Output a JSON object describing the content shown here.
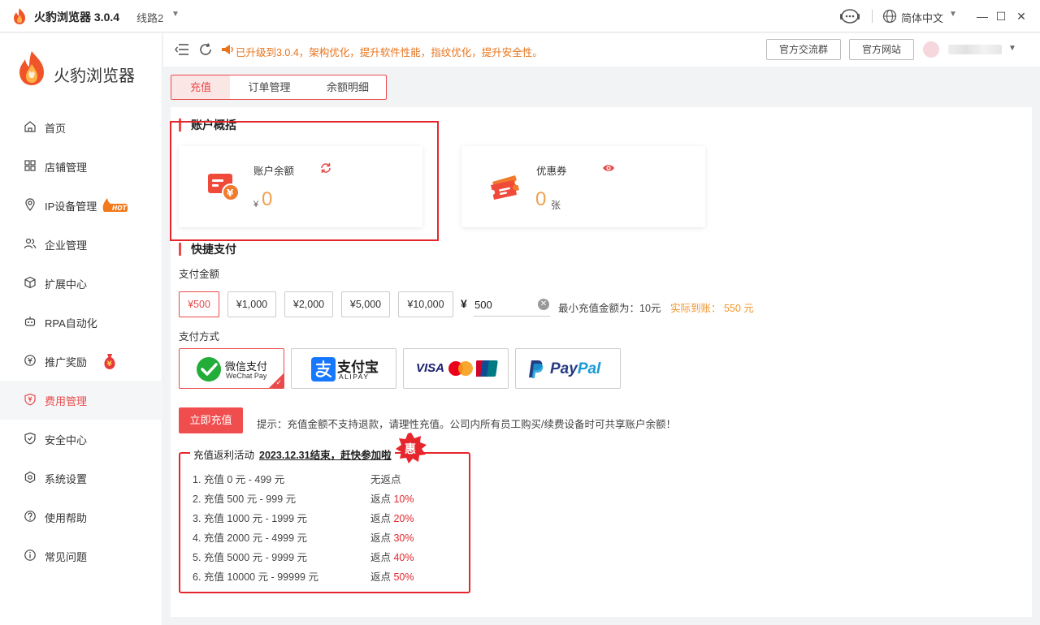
{
  "titlebar": {
    "app_title": "火豹浏览器 3.0.4",
    "line": "线路2",
    "language": "简体中文",
    "minimize": "—",
    "maximize": "☐",
    "close": "✕"
  },
  "sidebar": {
    "brand": "火豹浏览器",
    "items": [
      {
        "label": "首页",
        "icon": "home-icon"
      },
      {
        "label": "店铺管理",
        "icon": "grid-icon"
      },
      {
        "label": "IP设备管理",
        "icon": "location-icon",
        "badge": "HOT"
      },
      {
        "label": "企业管理",
        "icon": "users-icon"
      },
      {
        "label": "扩展中心",
        "icon": "cube-icon"
      },
      {
        "label": "RPA自动化",
        "icon": "robot-icon"
      },
      {
        "label": "推广奖励",
        "icon": "reward-icon",
        "badge": "¥"
      },
      {
        "label": "费用管理",
        "icon": "fee-icon",
        "active": true
      },
      {
        "label": "安全中心",
        "icon": "shield-icon"
      },
      {
        "label": "系统设置",
        "icon": "gear-icon"
      },
      {
        "label": "使用帮助",
        "icon": "help-icon"
      },
      {
        "label": "常见问题",
        "icon": "info-icon"
      }
    ]
  },
  "topbar": {
    "notice": "已升级到3.0.4，架构优化，提升软件性能，指纹优化，提升安全性。",
    "group_button": "官方交流群",
    "site_button": "官方网站"
  },
  "tabs": [
    {
      "label": "充值",
      "active": true
    },
    {
      "label": "订单管理"
    },
    {
      "label": "余额明细"
    }
  ],
  "overview": {
    "title": "账户概括",
    "balance_label": "账户余额",
    "balance_currency": "¥",
    "balance_value": "0",
    "coupon_label": "优惠券",
    "coupon_value": "0",
    "coupon_unit": "张"
  },
  "quickpay": {
    "title": "快捷支付",
    "amount_label": "支付金额",
    "amounts": [
      "¥500",
      "¥1,000",
      "¥2,000",
      "¥5,000",
      "¥10,000"
    ],
    "selected_amount_index": 0,
    "yen": "¥",
    "input_value": "500",
    "min_text": "最小充值金额为：10元",
    "actual_text": "实际到账： 550 元",
    "method_label": "支付方式",
    "methods": {
      "wechat_cn": "微信支付",
      "wechat_en": "WeChat Pay",
      "alipay_cn": "支付宝",
      "alipay_en": "ALIPAY",
      "visa": "VISA",
      "paypal_pay": "Pay",
      "paypal_pal": "Pal"
    },
    "submit": "立即充值",
    "tip": "提示：充值金额不支持退款，请理性充值。公司内所有员工购买/续费设备时可共享账户余额！"
  },
  "promo": {
    "title": "充值返利活动",
    "deadline": "2023.12.31结束，赶快参加啦",
    "badge": "惠",
    "rows": [
      {
        "range": "1. 充值 0 元 - 499 元",
        "rate_prefix": "无返点",
        "rate": ""
      },
      {
        "range": "2. 充值 500 元 - 999 元",
        "rate_prefix": "返点 ",
        "rate": "10%"
      },
      {
        "range": "3. 充值 1000 元 - 1999 元",
        "rate_prefix": "返点 ",
        "rate": "20%"
      },
      {
        "range": "4. 充值 2000 元 - 4999 元",
        "rate_prefix": "返点 ",
        "rate": "30%"
      },
      {
        "range": "5. 充值 5000 元 - 9999 元",
        "rate_prefix": "返点 ",
        "rate": "40%"
      },
      {
        "range": "6. 充值 10000 元 - 99999 元",
        "rate_prefix": "返点 ",
        "rate": "50%"
      }
    ]
  },
  "colors": {
    "accent": "#e94b4b",
    "highlight": "#e5262c",
    "value": "#f0a050",
    "notice": "#e8731a"
  }
}
